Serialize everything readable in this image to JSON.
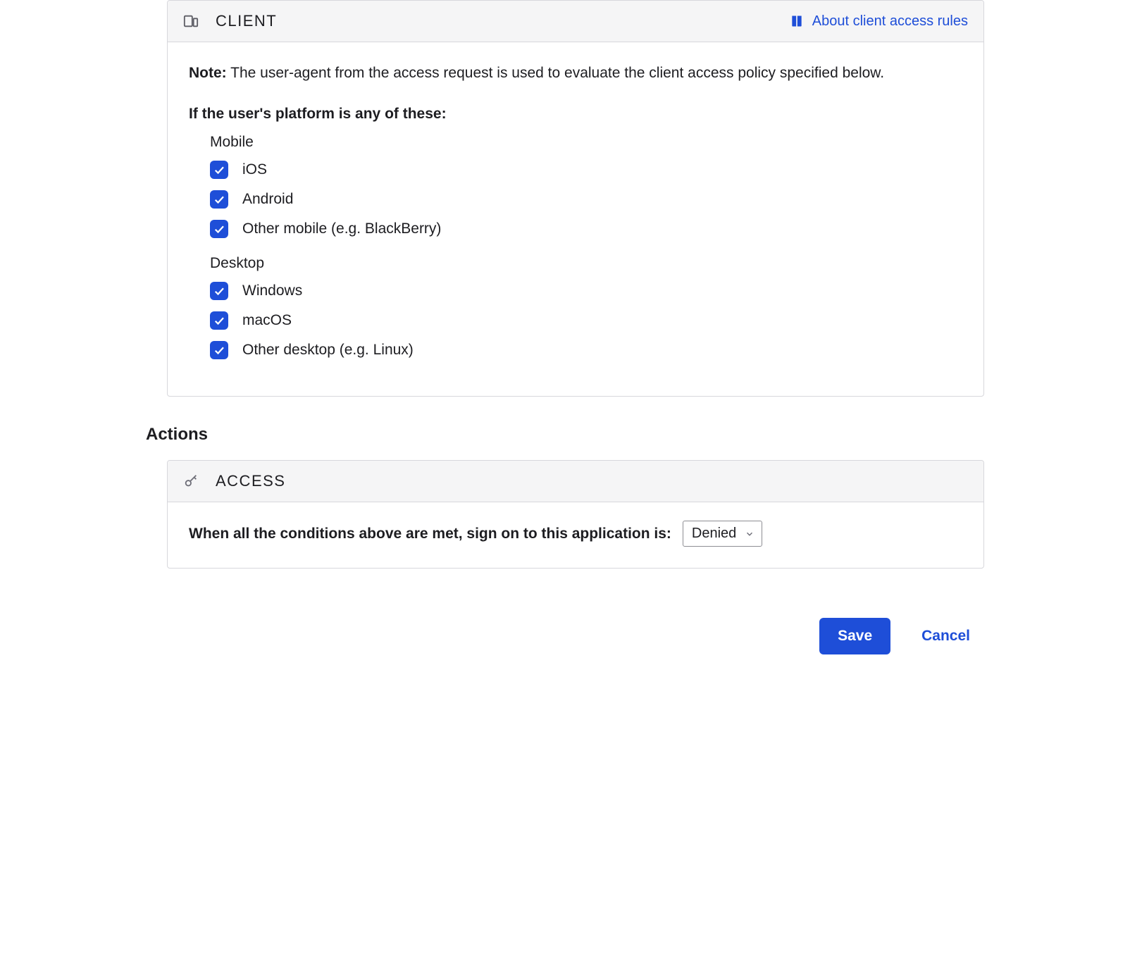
{
  "client": {
    "title": "CLIENT",
    "aboutLink": "About client access rules",
    "noteLabel": "Note:",
    "noteText": " The user-agent from the access request is used to evaluate the client access policy specified below.",
    "platformLabel": "If the user's platform is any of these:",
    "groups": {
      "mobile": {
        "heading": "Mobile",
        "items": [
          {
            "label": "iOS",
            "checked": true
          },
          {
            "label": "Android",
            "checked": true
          },
          {
            "label": "Other mobile (e.g. BlackBerry)",
            "checked": true
          }
        ]
      },
      "desktop": {
        "heading": "Desktop",
        "items": [
          {
            "label": "Windows",
            "checked": true
          },
          {
            "label": "macOS",
            "checked": true
          },
          {
            "label": "Other desktop (e.g. Linux)",
            "checked": true
          }
        ]
      }
    }
  },
  "actionsTitle": "Actions",
  "access": {
    "title": "ACCESS",
    "label": "When all the conditions above are met, sign on to this application is:",
    "selected": "Denied"
  },
  "buttons": {
    "save": "Save",
    "cancel": "Cancel"
  }
}
